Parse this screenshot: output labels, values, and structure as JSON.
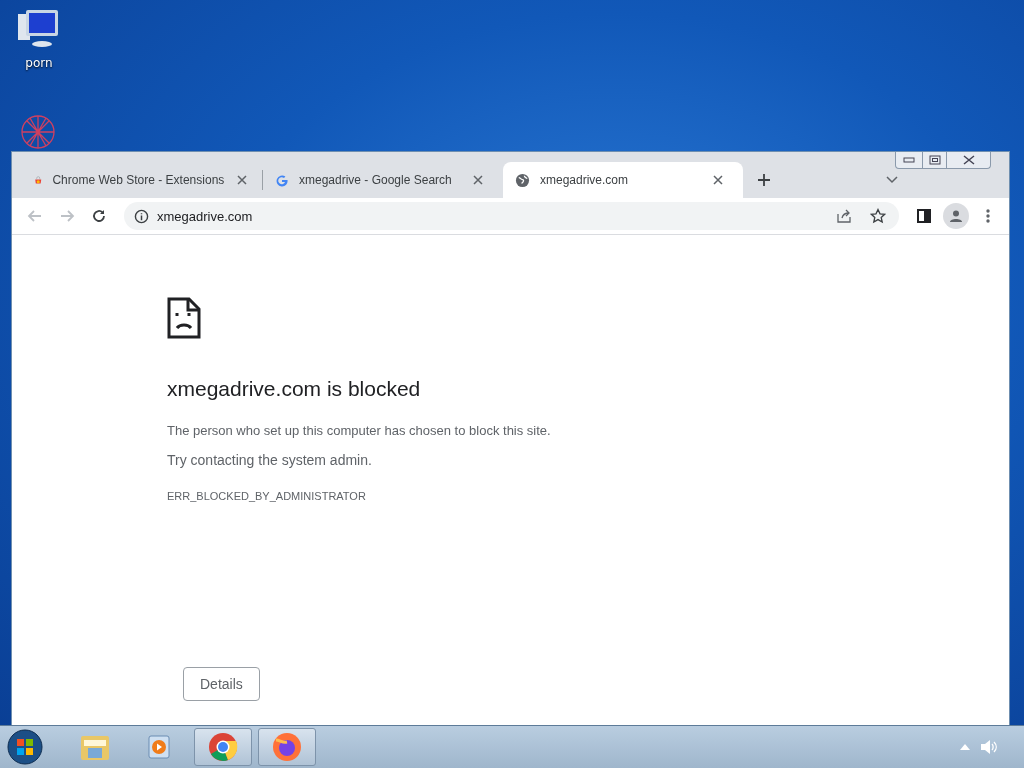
{
  "desktop_icons": [
    {
      "label": "porn",
      "kind": "computer"
    }
  ],
  "browser": {
    "tabs": [
      {
        "title": "Chrome Web Store - Extensions",
        "kind": "store",
        "selected": false
      },
      {
        "title": "xmegadrive - Google Search",
        "kind": "google",
        "selected": false
      },
      {
        "title": "xmegadrive.com",
        "kind": "globe",
        "selected": true
      }
    ],
    "address": "xmegadrive.com",
    "page": {
      "heading": "xmegadrive.com is blocked",
      "message": "The person who set up this computer has chosen to block this site.",
      "hint": "Try contacting the system admin.",
      "error_code": "ERR_BLOCKED_BY_ADMINISTRATOR",
      "details_button": "Details"
    }
  },
  "taskbar": {
    "items": [
      {
        "kind": "explorer",
        "running": false
      },
      {
        "kind": "media",
        "running": false
      },
      {
        "kind": "chrome",
        "running": true
      },
      {
        "kind": "firefox",
        "running": true
      }
    ]
  }
}
